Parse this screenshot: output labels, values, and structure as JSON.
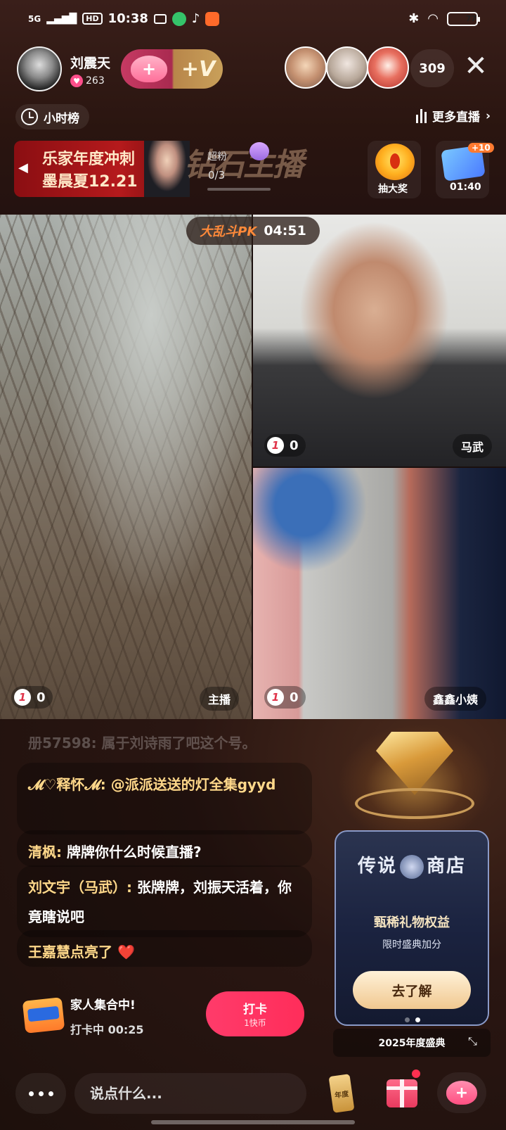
{
  "status_bar": {
    "network": "5G",
    "hd": "HD",
    "time": "10:38",
    "battery": "77"
  },
  "host": {
    "name": "刘震天",
    "likes": "263",
    "follow_icon": "plus-heart-icon",
    "member_label": "+V"
  },
  "viewers": {
    "count": "309"
  },
  "rank": {
    "label": "小时榜"
  },
  "more_live": {
    "label": "更多直播"
  },
  "banner": {
    "line1": "乐家年度冲刺",
    "line2": "墨晨夏12.21",
    "title": "钻石主播",
    "super_fans_label": "超粉",
    "super_fans_count": "0/3"
  },
  "lottery": {
    "label": "抽大奖"
  },
  "task": {
    "badge": "+10",
    "timer": "01:40"
  },
  "pk": {
    "title": "大乱斗PK",
    "time": "04:51"
  },
  "streams": [
    {
      "score": "0",
      "name": "主播"
    },
    {
      "score": "0",
      "name": "马武"
    },
    {
      "score": "0",
      "name": "鑫鑫小姨"
    }
  ],
  "score_icon_glyph": "1",
  "chat": {
    "faded": "册57598:  属于刘诗雨了吧这个号。",
    "messages": [
      {
        "user": "𝓜♡释怀𝓜:",
        "text": "@派派送送的灯全集gyyd"
      },
      {
        "user": "清枫:",
        "text": "牌牌你什么时候直播?"
      },
      {
        "user": "刘文宇（马武）:",
        "text": "张牌牌，刘振天活着，你竟瞎说吧"
      },
      {
        "user": "王嘉慧点亮了",
        "text": "❤️"
      }
    ]
  },
  "family": {
    "title": "家人集合中!",
    "status": "打卡中 00:25",
    "button_label": "打卡",
    "button_sub": "1快币"
  },
  "shop": {
    "title_left": "传说",
    "title_right": "商店",
    "subtitle": "甄稀礼物权益",
    "desc": "限时盛典加分",
    "button": "去了解",
    "annual": "2025年度盛典"
  },
  "bottom": {
    "input_placeholder": "说点什么...",
    "annual_card": "年度"
  },
  "colors": {
    "accent_pink": "#ff2d5a",
    "gold_name": "#ffd88a"
  }
}
